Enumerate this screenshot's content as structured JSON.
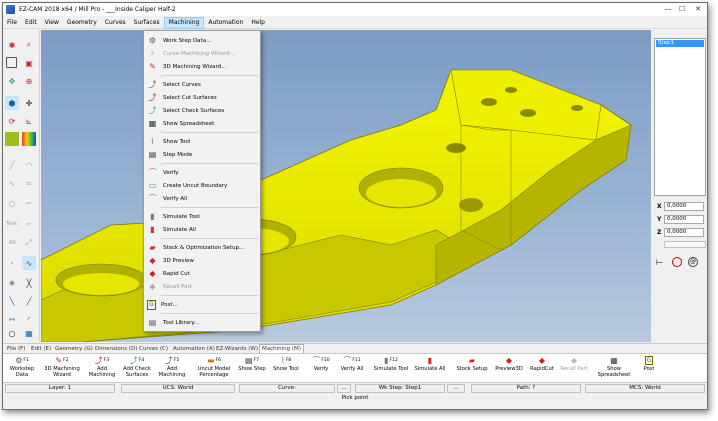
{
  "window": {
    "title": "EZ-CAM 2018 x64 / Mill Pro - ___Inside Caliper Half-2",
    "minimize": "—",
    "maximize": "☐",
    "close": "✕"
  },
  "menubar": [
    "File",
    "Edit",
    "View",
    "Geometry",
    "Curves",
    "Surfaces",
    "Machining",
    "Automation",
    "Help"
  ],
  "machining_menu": {
    "items": [
      {
        "label": "Work Step Data...",
        "icon": "work-step-icon",
        "enabled": true
      },
      {
        "label": "Curve Machining Wizard...",
        "icon": "curve-wizard-icon",
        "enabled": false
      },
      {
        "label": "3D Machining Wizard...",
        "icon": "3d-wizard-icon",
        "enabled": true
      },
      {
        "label": "Select Curves",
        "icon": "select-curves-icon",
        "enabled": true
      },
      {
        "label": "Select Cut Surfaces",
        "icon": "select-cut-surfaces-icon",
        "enabled": true
      },
      {
        "label": "Select Check Surfaces",
        "icon": "select-check-surfaces-icon",
        "enabled": true
      },
      {
        "label": "Show Spreadsheet",
        "icon": "spreadsheet-icon",
        "enabled": true
      },
      {
        "label": "Show Tool",
        "icon": "show-tool-icon",
        "enabled": true
      },
      {
        "label": "Step Mode",
        "icon": "step-mode-icon",
        "enabled": true
      },
      {
        "label": "Verify",
        "icon": "verify-icon",
        "enabled": true
      },
      {
        "label": "Create Uncut Boundary",
        "icon": "uncut-boundary-icon",
        "enabled": true
      },
      {
        "label": "Verify All",
        "icon": "verify-all-icon",
        "enabled": true
      },
      {
        "label": "Simulate Tool",
        "icon": "simulate-tool-icon",
        "enabled": true
      },
      {
        "label": "Simulate All",
        "icon": "simulate-all-icon",
        "enabled": true
      },
      {
        "label": "Stock & Optimization Setup...",
        "icon": "stock-setup-icon",
        "enabled": true
      },
      {
        "label": "3D Preview",
        "icon": "3d-preview-icon",
        "enabled": true
      },
      {
        "label": "Rapid Cut",
        "icon": "rapid-cut-icon",
        "enabled": true
      },
      {
        "label": "Recall Part",
        "icon": "recall-part-icon",
        "enabled": false
      },
      {
        "label": "Post...",
        "icon": "post-icon",
        "enabled": true
      },
      {
        "label": "Tool Library...",
        "icon": "tool-library-icon",
        "enabled": true
      }
    ]
  },
  "left_toolbar": {
    "text_label": "Text",
    "all_label": "All"
  },
  "right_panel": {
    "step_item": "Step1",
    "x_label": "X",
    "x_value": "0,0000",
    "y_label": "Y",
    "y_value": "0,0000",
    "z_label": "Z",
    "z_value": "0,0000"
  },
  "tabs": [
    "File (F)",
    "Edit (E)",
    "Geometry (G)",
    "Dimensions (D)",
    "Curves (C)",
    "Automation (A)",
    "EZ-Wizards (W)",
    "Machining (M)"
  ],
  "active_tab": "Machining (M)",
  "ribbon": [
    {
      "key": "F1",
      "label": "Workstep\nData",
      "icon": "workstep-data-icon",
      "enabled": true
    },
    {
      "key": "F2",
      "label": "3D Machining\nWizard",
      "icon": "3d-wizard-icon",
      "enabled": true
    },
    {
      "key": "F3",
      "label": "Add\nMachining",
      "icon": "add-machining-icon",
      "enabled": true
    },
    {
      "key": "F4",
      "label": "Add Check\nSurfaces",
      "icon": "add-check-surfaces-icon",
      "enabled": true
    },
    {
      "key": "F5",
      "label": "Add\nMachining",
      "icon": "add-machining-icon",
      "enabled": true
    },
    {
      "key": "F6",
      "label": "Uncut Model\nPercentage",
      "icon": "uncut-model-icon",
      "enabled": true
    },
    {
      "key": "F7",
      "label": "Show Step",
      "icon": "show-step-icon",
      "enabled": true
    },
    {
      "key": "F8",
      "label": "Show Tool",
      "icon": "show-tool-icon",
      "enabled": true
    },
    {
      "key": "F10",
      "label": "Verify",
      "icon": "verify-icon",
      "enabled": true
    },
    {
      "key": "F11",
      "label": "Verify All",
      "icon": "verify-all-icon",
      "enabled": true
    },
    {
      "key": "F12",
      "label": "Simulate Tool",
      "icon": "simulate-tool-icon",
      "enabled": true
    },
    {
      "key": "",
      "label": "Simulate All",
      "icon": "simulate-all-icon",
      "enabled": true
    },
    {
      "key": "",
      "label": "Stock Setup",
      "icon": "stock-setup-icon",
      "enabled": true
    },
    {
      "key": "",
      "label": "Preview3D",
      "icon": "preview3d-icon",
      "enabled": true
    },
    {
      "key": "",
      "label": "RapidCut",
      "icon": "rapid-cut-icon",
      "enabled": true
    },
    {
      "key": "",
      "label": "Recall Part",
      "icon": "recall-part-icon",
      "enabled": false
    },
    {
      "key": "",
      "label": "Show\nSpreadsheet",
      "icon": "spreadsheet-icon",
      "enabled": true
    },
    {
      "key": "",
      "label": "Post",
      "icon": "post-icon",
      "enabled": true
    }
  ],
  "status": {
    "layer": "Layer: 1",
    "ucs": "UCS: World",
    "curve": "Curve:",
    "curve_btn": "...",
    "wk_step": "Wk Step: Step1",
    "wk_btn": "...",
    "path": "Path: ?",
    "mcs": "MCS: World",
    "hint": "Pick point"
  },
  "colors": {
    "part": "#e6e600",
    "part_dark": "#a8a800",
    "viewport_top": "#7d9cc4",
    "highlight": "#3399ff"
  }
}
